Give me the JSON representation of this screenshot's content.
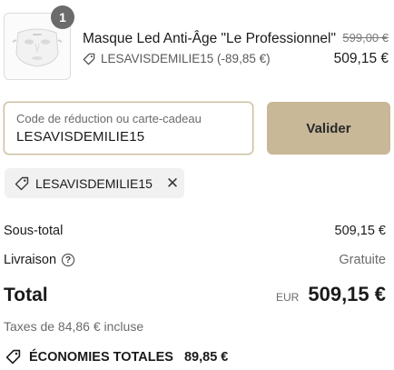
{
  "product": {
    "quantity": "1",
    "name": "Masque Led Anti-Âge \"Le Professionnel\"",
    "original_price": "599,00 €",
    "discount": "LESAVISDEMILIE15 (-89,85 €)",
    "price": "509,15 €"
  },
  "discount_form": {
    "placeholder": "Code de réduction ou carte-cadeau",
    "value": "LESAVISDEMILIE15",
    "apply_label": "Valider"
  },
  "applied_code": "LESAVISDEMILIE15",
  "summary": {
    "subtotal_label": "Sous-total",
    "subtotal_value": "509,15 €",
    "shipping_label": "Livraison",
    "shipping_value": "Gratuite",
    "total_label": "Total",
    "currency": "EUR",
    "total_value": "509,15 €",
    "taxes": "Taxes de 84,86 € incluse",
    "savings_label": "ÉCONOMIES TOTALES",
    "savings_value": "89,85 €"
  },
  "colors": {
    "accent_button": "#c8b898",
    "field_border": "#c9b99a",
    "chip_bg": "#f1f1f1"
  }
}
